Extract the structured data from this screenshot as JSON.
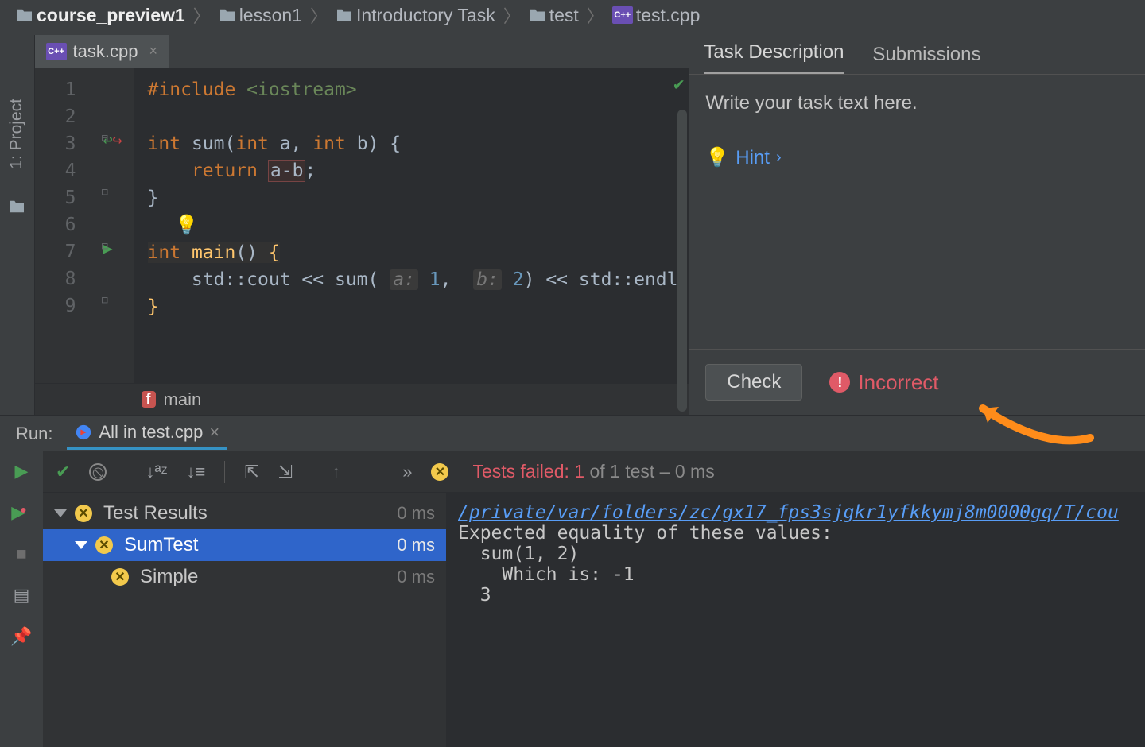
{
  "breadcrumb": {
    "items": [
      {
        "label": "course_preview1",
        "icon": "folder"
      },
      {
        "label": "lesson1",
        "icon": "folder"
      },
      {
        "label": "Introductory Task",
        "icon": "folder"
      },
      {
        "label": "test",
        "icon": "folder"
      },
      {
        "label": "test.cpp",
        "icon": "cpp"
      }
    ]
  },
  "project_label": "1: Project",
  "editor_tab": {
    "filename": "task.cpp"
  },
  "code": {
    "l1": {
      "inc": "#include",
      "str": "<iostream>"
    },
    "l3": {
      "kw1": "int",
      "fn": "sum",
      "kw2": "int",
      "p1": "a",
      "kw3": "int",
      "p2": "b"
    },
    "l4": {
      "kw": "return",
      "expr": "a-b"
    },
    "l7": {
      "kw": "int",
      "fn": "main"
    },
    "l8": {
      "cout": "std::cout",
      "op1": "<<",
      "call": "sum",
      "h1": "a:",
      "n1": "1",
      "h2": "b:",
      "n2": "2",
      "op2": "<<",
      "endl": "std::endl"
    }
  },
  "gutter": {
    "n1": "1",
    "n2": "2",
    "n3": "3",
    "n4": "4",
    "n5": "5",
    "n6": "6",
    "n7": "7",
    "n8": "8",
    "n9": "9"
  },
  "breadcrumb_bottom": {
    "fn": "main"
  },
  "task": {
    "tab_desc": "Task Description",
    "tab_sub": "Submissions",
    "body": "Write your task text here.",
    "hint": "Hint",
    "check": "Check",
    "status": "Incorrect"
  },
  "run": {
    "label": "Run:",
    "tab": "All in test.cpp",
    "fail_prefix": "Tests failed:",
    "fail_count": "1",
    "fail_suffix": "of 1 test – 0 ms",
    "tree": {
      "root": {
        "label": "Test Results",
        "time": "0 ms"
      },
      "suite": {
        "label": "SumTest",
        "time": "0 ms"
      },
      "test": {
        "label": "Simple",
        "time": "0 ms"
      }
    },
    "double_chevron": "»",
    "output": {
      "path": "/private/var/folders/zc/gx17_fps3sjgkr1yfkkymj8m0000gq/T/cou",
      "l1": "Expected equality of these values:",
      "l2": "  sum(1, 2)",
      "l3": "    Which is: -1",
      "l4": "  3"
    }
  }
}
